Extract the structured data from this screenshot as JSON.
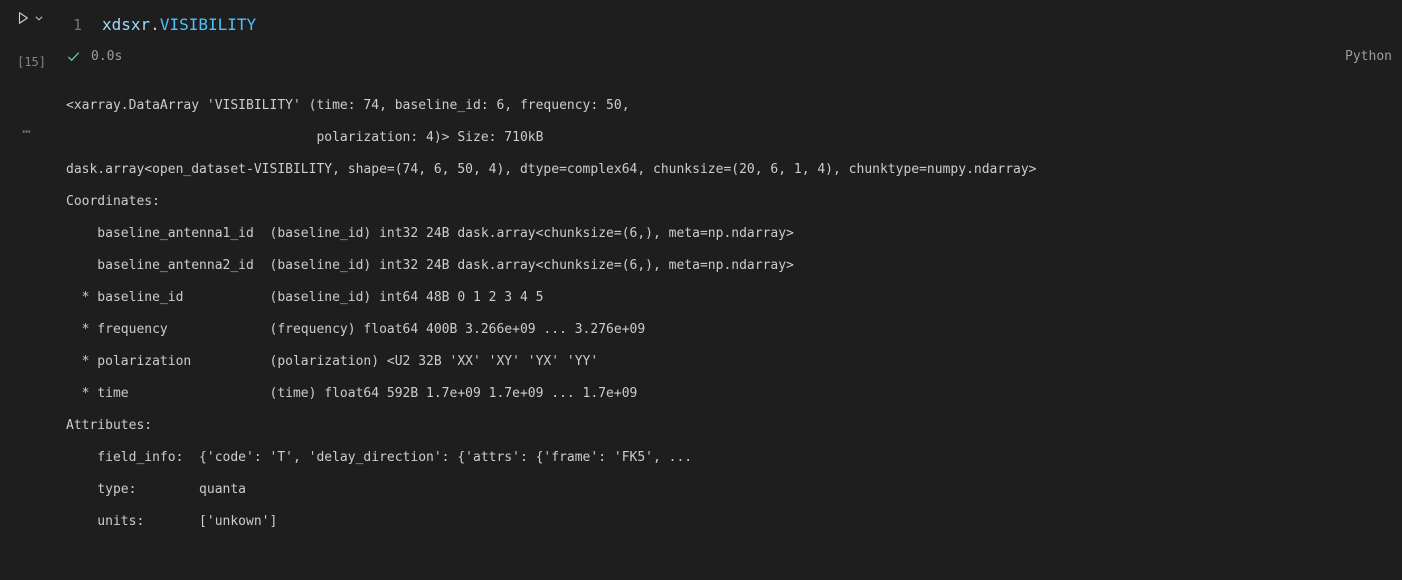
{
  "cell": {
    "execution_count": "[15]",
    "line_number": "1",
    "code_var": "xdsxr",
    "code_dot": ".",
    "code_const": "VISIBILITY",
    "duration": "0.0s",
    "language": "Python"
  },
  "output": {
    "line1": "<xarray.DataArray 'VISIBILITY' (time: 74, baseline_id: 6, frequency: 50,",
    "line2": "                                polarization: 4)> Size: 710kB",
    "line3": "dask.array<open_dataset-VISIBILITY, shape=(74, 6, 50, 4), dtype=complex64, chunksize=(20, 6, 1, 4), chunktype=numpy.ndarray>",
    "line4": "Coordinates:",
    "line5": "    baseline_antenna1_id  (baseline_id) int32 24B dask.array<chunksize=(6,), meta=np.ndarray>",
    "line6": "    baseline_antenna2_id  (baseline_id) int32 24B dask.array<chunksize=(6,), meta=np.ndarray>",
    "line7": "  * baseline_id           (baseline_id) int64 48B 0 1 2 3 4 5",
    "line8": "  * frequency             (frequency) float64 400B 3.266e+09 ... 3.276e+09",
    "line9": "  * polarization          (polarization) <U2 32B 'XX' 'XY' 'YX' 'YY'",
    "line10": "  * time                  (time) float64 592B 1.7e+09 1.7e+09 ... 1.7e+09",
    "line11": "Attributes:",
    "line12": "    field_info:  {'code': 'T', 'delay_direction': {'attrs': {'frame': 'FK5', ...",
    "line13": "    type:        quanta",
    "line14": "    units:       ['unkown']"
  }
}
